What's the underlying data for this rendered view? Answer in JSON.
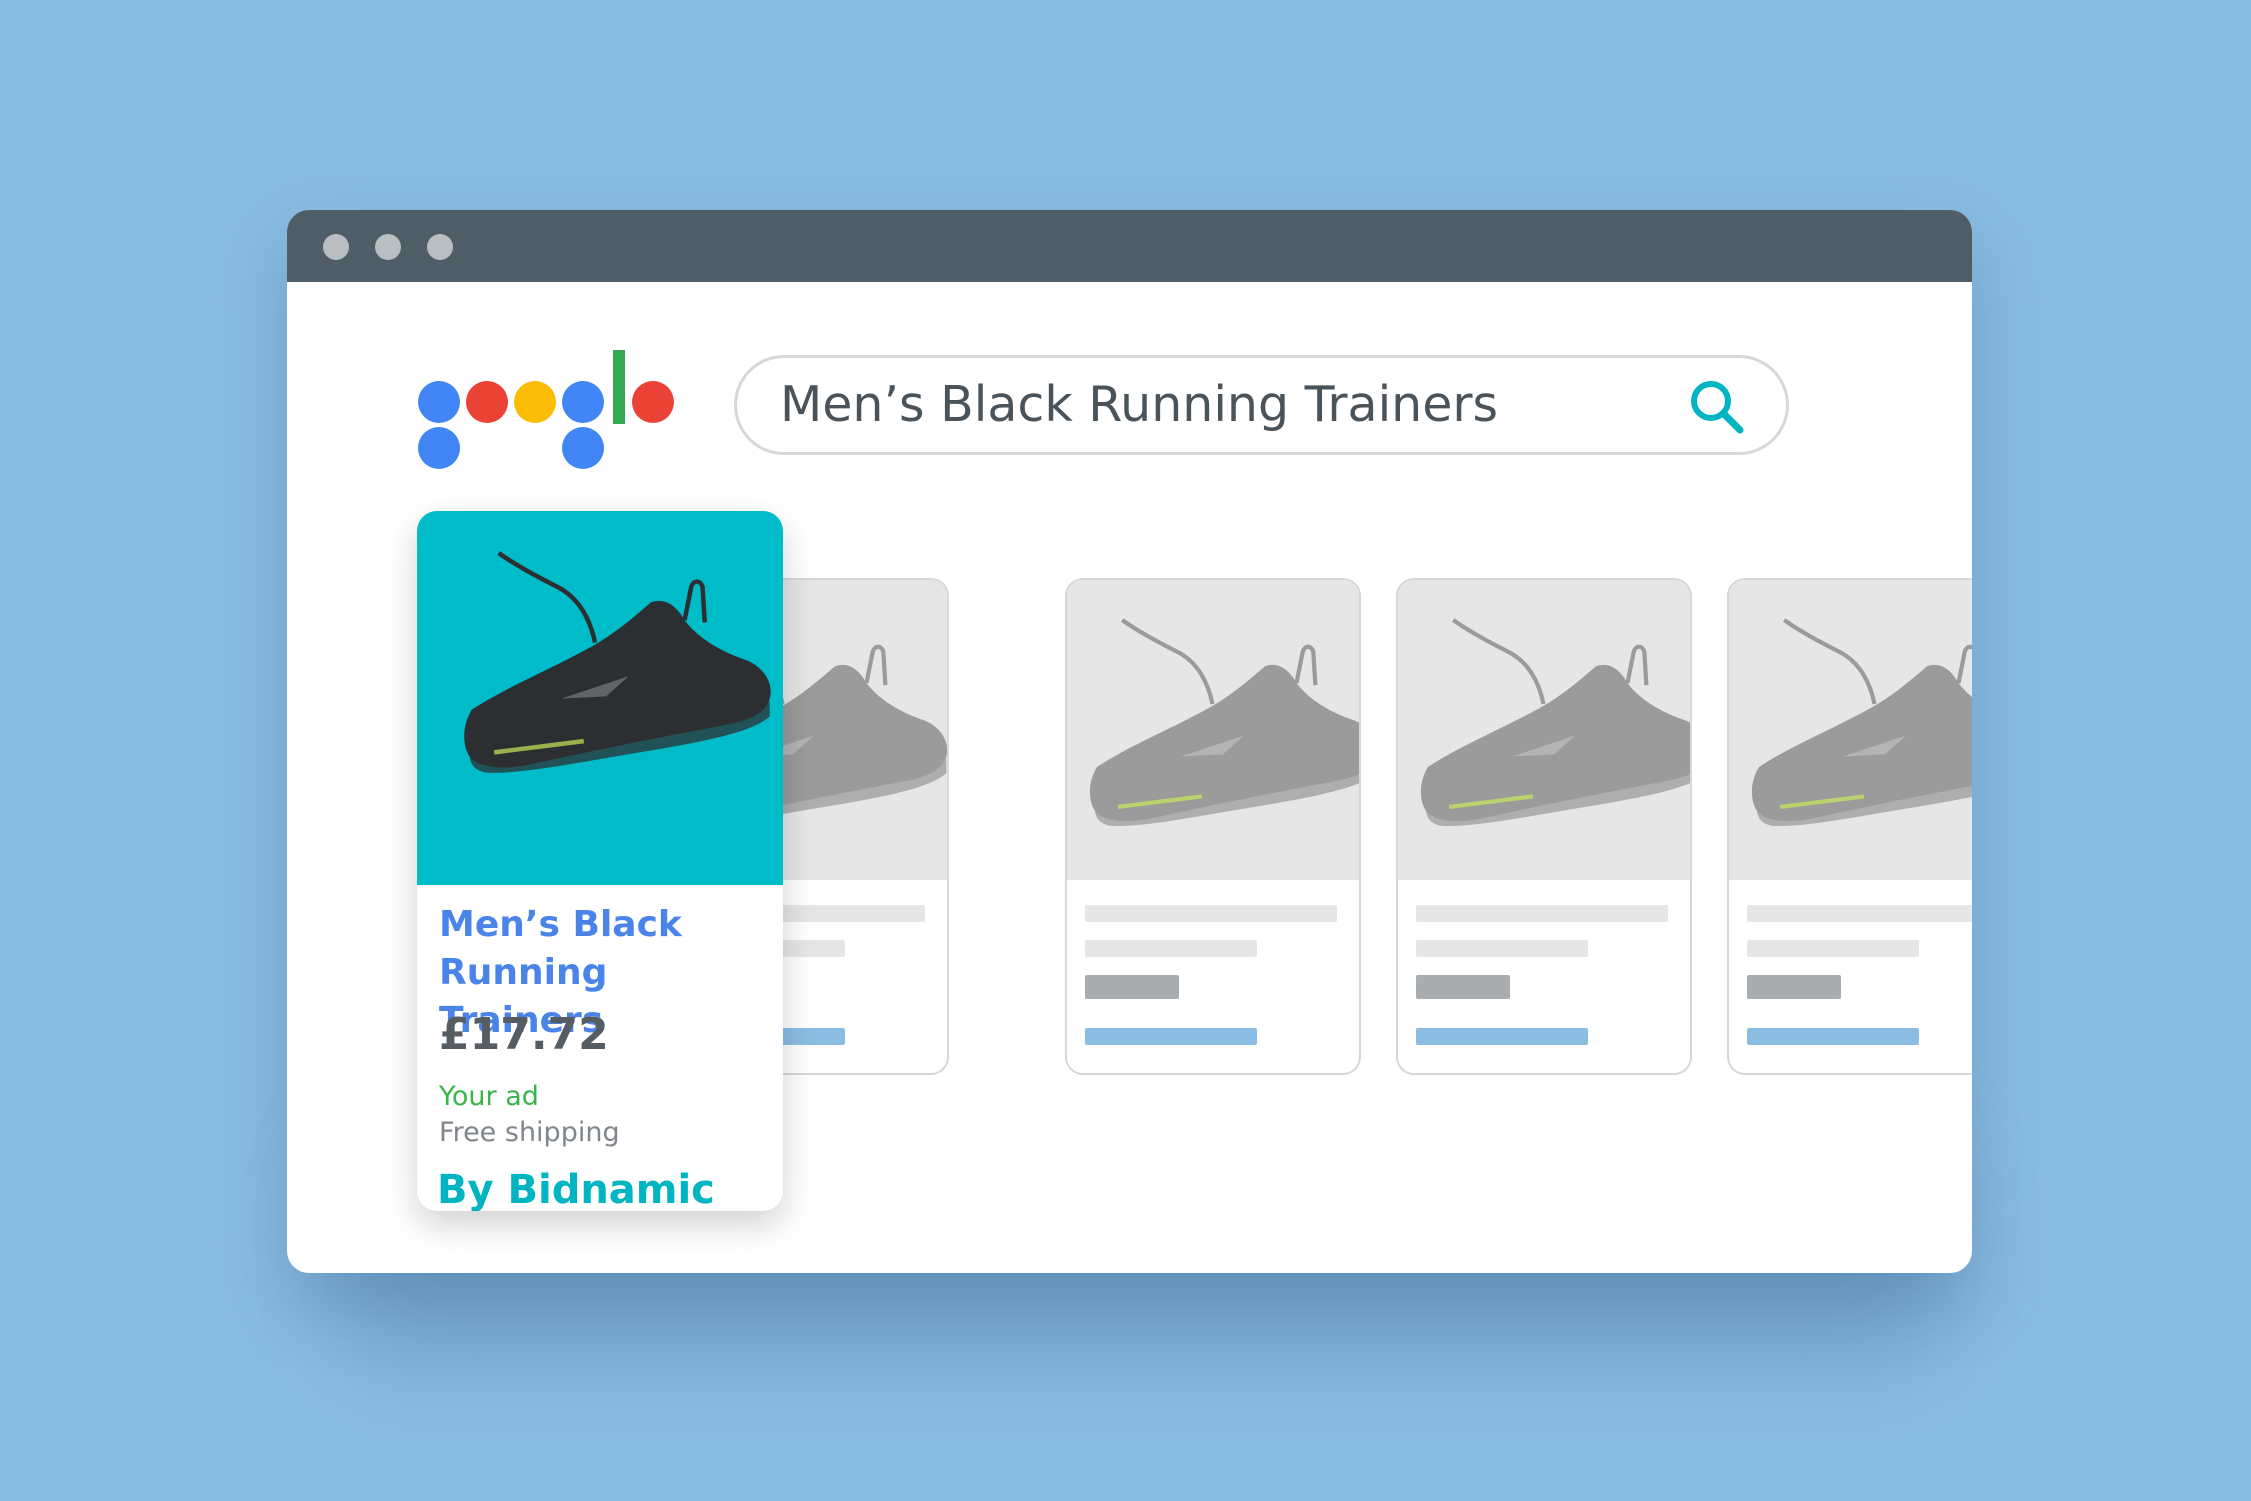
{
  "colors": {
    "background": "#89bce3",
    "titlebar": "#4f5e66",
    "accent_teal": "#00b5c2",
    "title_blue": "#4a84e8",
    "ad_green": "#3ab54a",
    "logo_blue": "#4285f4",
    "logo_red": "#ea4335",
    "logo_yellow": "#fbbc05",
    "logo_green": "#34a853"
  },
  "window": {
    "controls": [
      "window-dot",
      "window-dot",
      "window-dot"
    ]
  },
  "logo": {
    "icon": "google-dots-logo"
  },
  "search": {
    "query": "Men’s Black Running Trainers",
    "icon": "search-icon"
  },
  "featured": {
    "title": "Men’s Black Running Trainers",
    "price": "£17.72",
    "tag": "Your ad",
    "shipping": "Free shipping",
    "byline": "By Bidnamic"
  },
  "placeholder_cards": [
    {
      "icon": "shoe-image"
    },
    {
      "icon": "shoe-image"
    },
    {
      "icon": "shoe-image"
    },
    {
      "icon": "shoe-image"
    },
    {
      "icon": "shoe-image"
    }
  ]
}
